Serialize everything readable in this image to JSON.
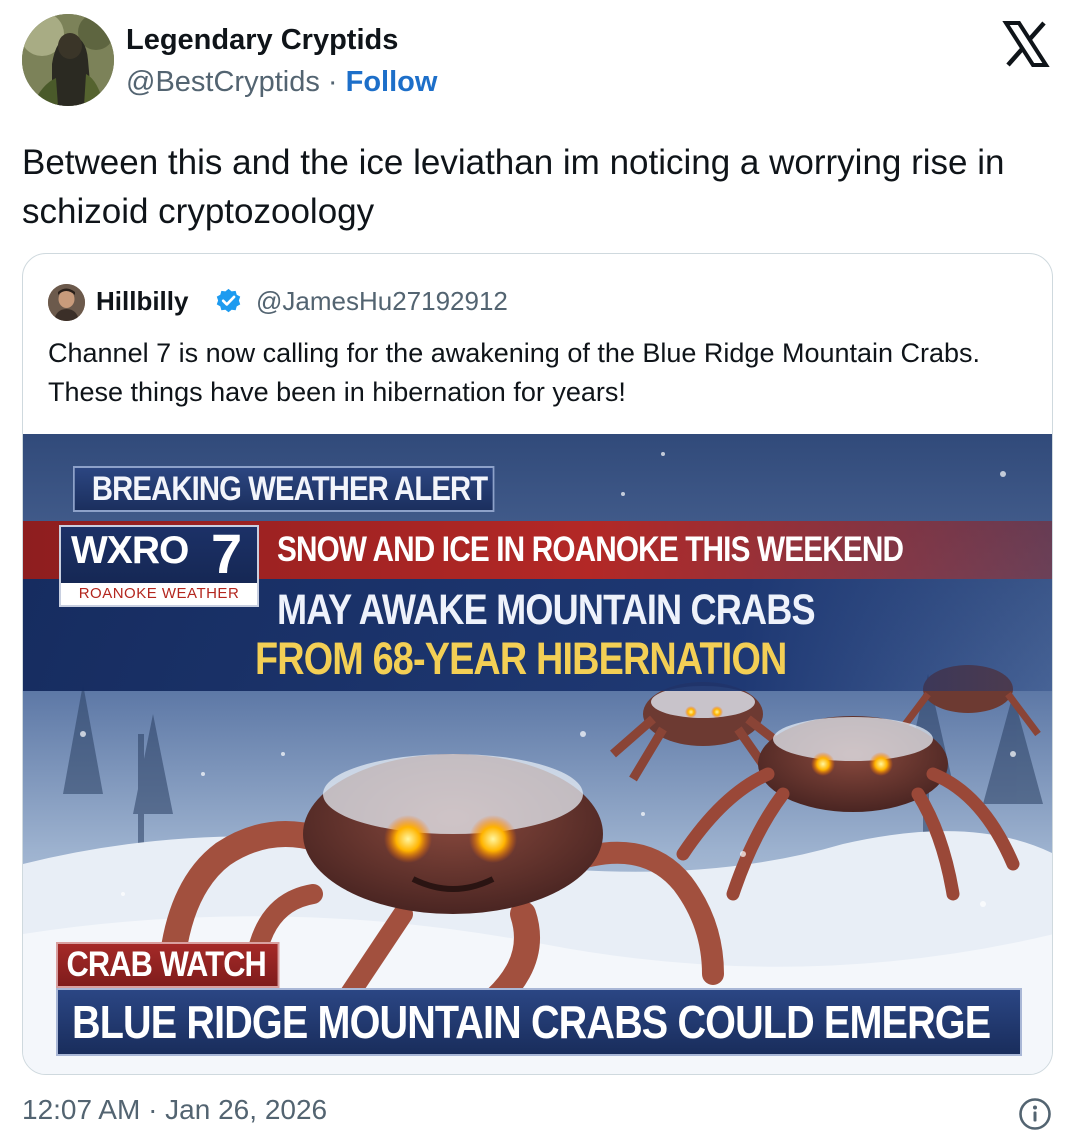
{
  "post": {
    "author_name": "Legendary Cryptids",
    "author_handle": "@BestCryptids",
    "separator": " · ",
    "follow_label": "Follow",
    "text": "Between this and the ice leviathan im noticing a worrying rise in schizoid cryptozoology",
    "timestamp": "12:07 AM · Jan 26, 2026"
  },
  "quoted": {
    "author_name": "Hillbilly",
    "author_handle": "@JamesHu27192912",
    "verified": true,
    "text": "Channel 7 is now calling for the awakening of the Blue Ridge Mountain Crabs. These things have been in hibernation for years!",
    "media": {
      "breaking_banner": "BREAKING WEATHER ALERT",
      "station_call_sign": "WXRO",
      "station_number": "7",
      "station_tagline": "ROANOKE WEATHER",
      "headline_line1": "SNOW AND ICE IN ROANOKE THIS WEEKEND",
      "headline_line2": "MAY AWAKE MOUNTAIN CRABS",
      "headline_line3": "FROM 68-YEAR HIBERNATION",
      "tag": "CRAB WATCH",
      "lower_third": "BLUE RIDGE MOUNTAIN CRABS COULD EMERGE"
    }
  },
  "icons": {
    "platform_logo": "x-logo-icon",
    "verified": "verified-badge-icon",
    "info": "info-icon"
  },
  "colors": {
    "follow_link": "#1d6fc9",
    "verified_badge": "#1d9bf0",
    "secondary_text": "#536471",
    "alert_red": "#b32826",
    "alert_navy": "#1b2f5e",
    "headline_gold": "#f3cf55"
  }
}
